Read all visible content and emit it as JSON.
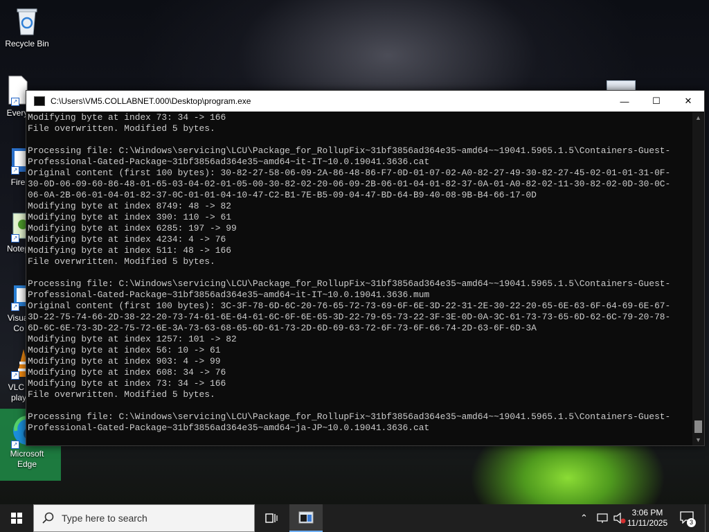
{
  "desktop": {
    "icons": [
      {
        "label": "Recycle Bin"
      },
      {
        "label": "Every"
      },
      {
        "label": "Fire"
      },
      {
        "label": "Notep"
      },
      {
        "label": "Visual\nCo"
      },
      {
        "label": "VLC r\nplay"
      },
      {
        "label": "Microsoft\nEdge"
      }
    ]
  },
  "console": {
    "title": "C:\\Users\\VM5.COLLABNET.000\\Desktop\\program.exe",
    "lines": [
      "Modifying byte at index 73: 34 -> 166",
      "File overwritten. Modified 5 bytes.",
      "",
      "Processing file: C:\\Windows\\servicing\\LCU\\Package_for_RollupFix~31bf3856ad364e35~amd64~~19041.5965.1.5\\Containers-Guest-",
      "Professional-Gated-Package~31bf3856ad364e35~amd64~it-IT~10.0.19041.3636.cat",
      "Original content (first 100 bytes): 30-82-27-58-06-09-2A-86-48-86-F7-0D-01-07-02-A0-82-27-49-30-82-27-45-02-01-01-31-0F-",
      "30-0D-06-09-60-86-48-01-65-03-04-02-01-05-00-30-82-02-20-06-09-2B-06-01-04-01-82-37-0A-01-A0-82-02-11-30-82-02-0D-30-0C-",
      "06-0A-2B-06-01-04-01-82-37-0C-01-01-04-10-47-C2-B1-7E-B5-09-04-47-BD-64-B9-40-08-9B-B4-66-17-0D",
      "Modifying byte at index 8749: 48 -> 82",
      "Modifying byte at index 390: 110 -> 61",
      "Modifying byte at index 6285: 197 -> 99",
      "Modifying byte at index 4234: 4 -> 76",
      "Modifying byte at index 511: 48 -> 166",
      "File overwritten. Modified 5 bytes.",
      "",
      "Processing file: C:\\Windows\\servicing\\LCU\\Package_for_RollupFix~31bf3856ad364e35~amd64~~19041.5965.1.5\\Containers-Guest-",
      "Professional-Gated-Package~31bf3856ad364e35~amd64~it-IT~10.0.19041.3636.mum",
      "Original content (first 100 bytes): 3C-3F-78-6D-6C-20-76-65-72-73-69-6F-6E-3D-22-31-2E-30-22-20-65-6E-63-6F-64-69-6E-67-",
      "3D-22-75-74-66-2D-38-22-20-73-74-61-6E-64-61-6C-6F-6E-65-3D-22-79-65-73-22-3F-3E-0D-0A-3C-61-73-73-65-6D-62-6C-79-20-78-",
      "6D-6C-6E-73-3D-22-75-72-6E-3A-73-63-68-65-6D-61-73-2D-6D-69-63-72-6F-73-6F-66-74-2D-63-6F-6D-3A",
      "Modifying byte at index 1257: 101 -> 82",
      "Modifying byte at index 56: 10 -> 61",
      "Modifying byte at index 903: 4 -> 99",
      "Modifying byte at index 608: 34 -> 76",
      "Modifying byte at index 73: 34 -> 166",
      "File overwritten. Modified 5 bytes.",
      "",
      "Processing file: C:\\Windows\\servicing\\LCU\\Package_for_RollupFix~31bf3856ad364e35~amd64~~19041.5965.1.5\\Containers-Guest-",
      "Professional-Gated-Package~31bf3856ad364e35~amd64~ja-JP~10.0.19041.3636.cat"
    ]
  },
  "taskbar": {
    "search_placeholder": "Type here to search",
    "clock_time": "3:06 PM",
    "clock_date": "11/11/2025",
    "notification_count": "3"
  }
}
